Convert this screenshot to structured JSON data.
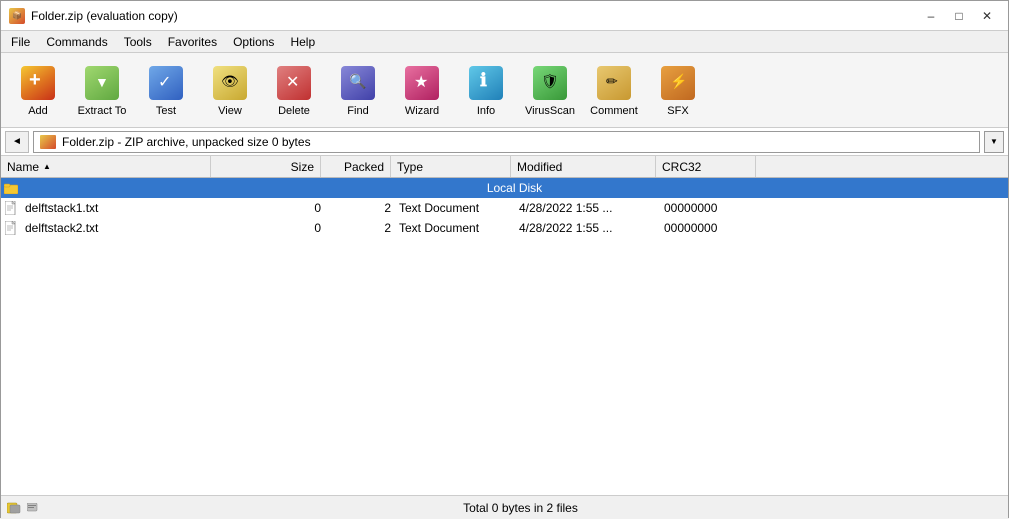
{
  "titleBar": {
    "title": "Folder.zip (evaluation copy)",
    "minimize": "–",
    "maximize": "□",
    "close": "✕"
  },
  "menuBar": {
    "items": [
      "File",
      "Commands",
      "Tools",
      "Favorites",
      "Options",
      "Help"
    ]
  },
  "toolbar": {
    "buttons": [
      {
        "id": "add",
        "label": "Add",
        "iconClass": "ti-add"
      },
      {
        "id": "extract",
        "label": "Extract To",
        "iconClass": "ti-extract"
      },
      {
        "id": "test",
        "label": "Test",
        "iconClass": "ti-test"
      },
      {
        "id": "view",
        "label": "View",
        "iconClass": "ti-view"
      },
      {
        "id": "delete",
        "label": "Delete",
        "iconClass": "ti-delete"
      },
      {
        "id": "find",
        "label": "Find",
        "iconClass": "ti-find"
      },
      {
        "id": "wizard",
        "label": "Wizard",
        "iconClass": "ti-wizard"
      },
      {
        "id": "info",
        "label": "Info",
        "iconClass": "ti-info"
      },
      {
        "id": "virusscan",
        "label": "VirusScan",
        "iconClass": "ti-virus"
      },
      {
        "id": "comment",
        "label": "Comment",
        "iconClass": "ti-comment"
      },
      {
        "id": "sfx",
        "label": "SFX",
        "iconClass": "ti-sfx"
      }
    ]
  },
  "addressBar": {
    "text": "Folder.zip - ZIP archive, unpacked size 0 bytes"
  },
  "columns": {
    "name": "Name",
    "size": "Size",
    "packed": "Packed",
    "type": "Type",
    "modified": "Modified",
    "crc32": "CRC32"
  },
  "localDisk": {
    "label": "Local Disk"
  },
  "files": [
    {
      "name": "delftstack1.txt",
      "size": "0",
      "packed": "2",
      "type": "Text Document",
      "modified": "4/28/2022 1:55 ...",
      "crc32": "00000000"
    },
    {
      "name": "delftstack2.txt",
      "size": "0",
      "packed": "2",
      "type": "Text Document",
      "modified": "4/28/2022 1:55 ...",
      "crc32": "00000000"
    }
  ],
  "statusBar": {
    "text": "Total 0 bytes in 2 files"
  }
}
